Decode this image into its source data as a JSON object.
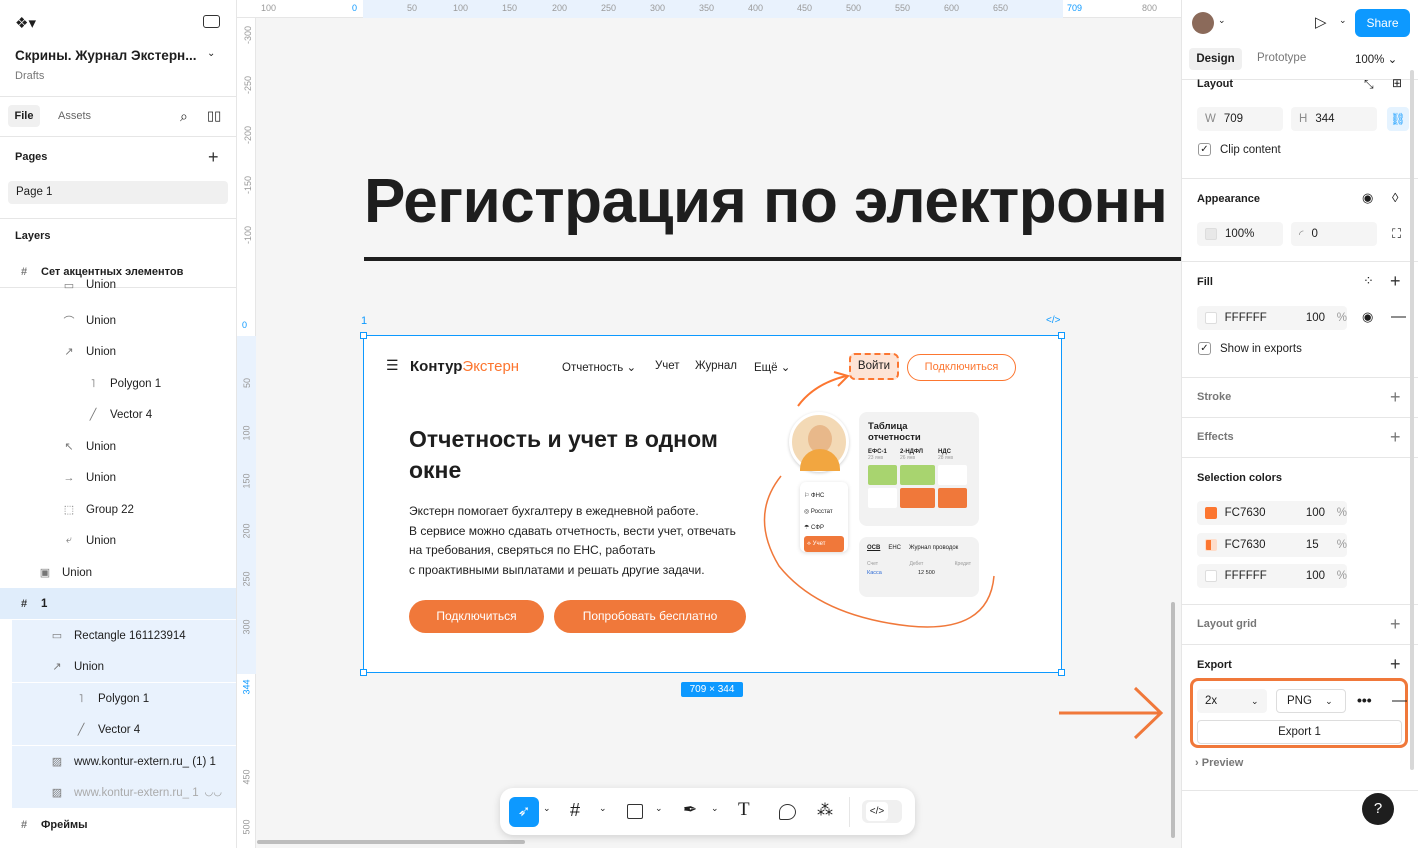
{
  "left": {
    "file_title": "Скрины. Журнал Экстерн...",
    "subtitle": "Drafts",
    "tabs": [
      "File",
      "Assets"
    ],
    "pages_heading": "Pages",
    "page": "Page 1",
    "layers_heading": "Layers",
    "layers": [
      {
        "name": "Сет акцентных элементов",
        "icon": "#"
      },
      {
        "name": "Union",
        "icon": "▭"
      },
      {
        "name": "Union",
        "icon": "⌒"
      },
      {
        "name": "Union",
        "icon": "↗"
      },
      {
        "name": "Polygon 1",
        "icon": "˥"
      },
      {
        "name": "Vector 4",
        "icon": "╱"
      },
      {
        "name": "Union",
        "icon": "↖"
      },
      {
        "name": "Union",
        "icon": "→"
      },
      {
        "name": "Group 22",
        "icon": "⬚"
      },
      {
        "name": "Union",
        "icon": "⤶"
      },
      {
        "name": "Union",
        "icon": "▣"
      },
      {
        "name": "1",
        "icon": "#"
      },
      {
        "name": "Rectangle 161123914",
        "icon": "▭"
      },
      {
        "name": "Union",
        "icon": "↗"
      },
      {
        "name": "Polygon 1",
        "icon": "˥"
      },
      {
        "name": "Vector 4",
        "icon": "╱"
      },
      {
        "name": "www.kontur-extern.ru_ (1) 1",
        "icon": "▨"
      },
      {
        "name": "www.kontur-extern.ru_ 1",
        "icon": "▨"
      },
      {
        "name": "Фреймы",
        "icon": "#"
      }
    ]
  },
  "ruler": {
    "top": [
      "100",
      "0",
      "50",
      "100",
      "150",
      "200",
      "250",
      "300",
      "350",
      "400",
      "450",
      "500",
      "550",
      "600",
      "650",
      "709",
      "800"
    ],
    "left": [
      "-300",
      "-250",
      "-200",
      "-150",
      "-100",
      "0",
      "50",
      "100",
      "150",
      "200",
      "250",
      "300",
      "344",
      "450",
      "500"
    ]
  },
  "canvas": {
    "heading": "Регистрация по электронн",
    "frame_label": "1",
    "size_badge": "709 × 344",
    "code_icon": "</>"
  },
  "site": {
    "logo_a": "Контур",
    "logo_b": "Экстерн",
    "nav": [
      "Отчетность",
      "Учет",
      "Журнал",
      "Ещё"
    ],
    "login": "Войти",
    "connect": "Подключиться",
    "title": "Отчетность и учет в одном окне",
    "desc": [
      "Экстерн помогает бухгалтеру в ежедневной работе.",
      "В сервисе можно сдавать отчетность, вести учет, отвечать",
      "на требования, сверяться по ЕНС, работать",
      "с проактивными выплатами и решать другие задачи."
    ],
    "btn_primary": "Подключиться",
    "btn_secondary": "Попробовать бесплатно",
    "card_title": "Таблица отчетности",
    "card_cols": [
      "ЕФС-1",
      "2-НДФЛ",
      "НДС"
    ],
    "card_dates": [
      "23 янв",
      "26 янв",
      "28 янв"
    ],
    "menu": [
      "ФНС",
      "Росстат",
      "СФР",
      "Учет"
    ],
    "tabs2": [
      "ОСВ",
      "ЕНС",
      "Журнал проводок"
    ],
    "tbl_head": [
      "Счет",
      "Дебет",
      "Кредит"
    ],
    "tbl_row": [
      "Касса",
      "12 500",
      ""
    ]
  },
  "right": {
    "tabs": [
      "Design",
      "Prototype"
    ],
    "zoom": "100%",
    "share": "Share",
    "layout": "Layout",
    "w_label": "W",
    "w": "709",
    "h_label": "H",
    "h": "344",
    "clip": "Clip content",
    "appearance": "Appearance",
    "opacity": "100%",
    "radius": "0",
    "fill": "Fill",
    "fill_hex": "FFFFFF",
    "fill_op": "100",
    "pct": "%",
    "show_exports": "Show in exports",
    "stroke": "Stroke",
    "effects": "Effects",
    "selection_colors": "Selection colors",
    "colors": [
      {
        "hex": "FC7630",
        "op": "100",
        "color": "#FC7630"
      },
      {
        "hex": "FC7630",
        "op": "15",
        "color": "#FEDDCB"
      },
      {
        "hex": "FFFFFF",
        "op": "100",
        "color": "#FFFFFF"
      }
    ],
    "layout_grid": "Layout grid",
    "export": "Export",
    "scale": "2x",
    "format": "PNG",
    "export_btn": "Export 1",
    "preview": "Preview",
    "help": "?"
  },
  "colors": {
    "accent": "#FC7630",
    "selection": "#0D99FF",
    "share": "#0D99FF"
  }
}
